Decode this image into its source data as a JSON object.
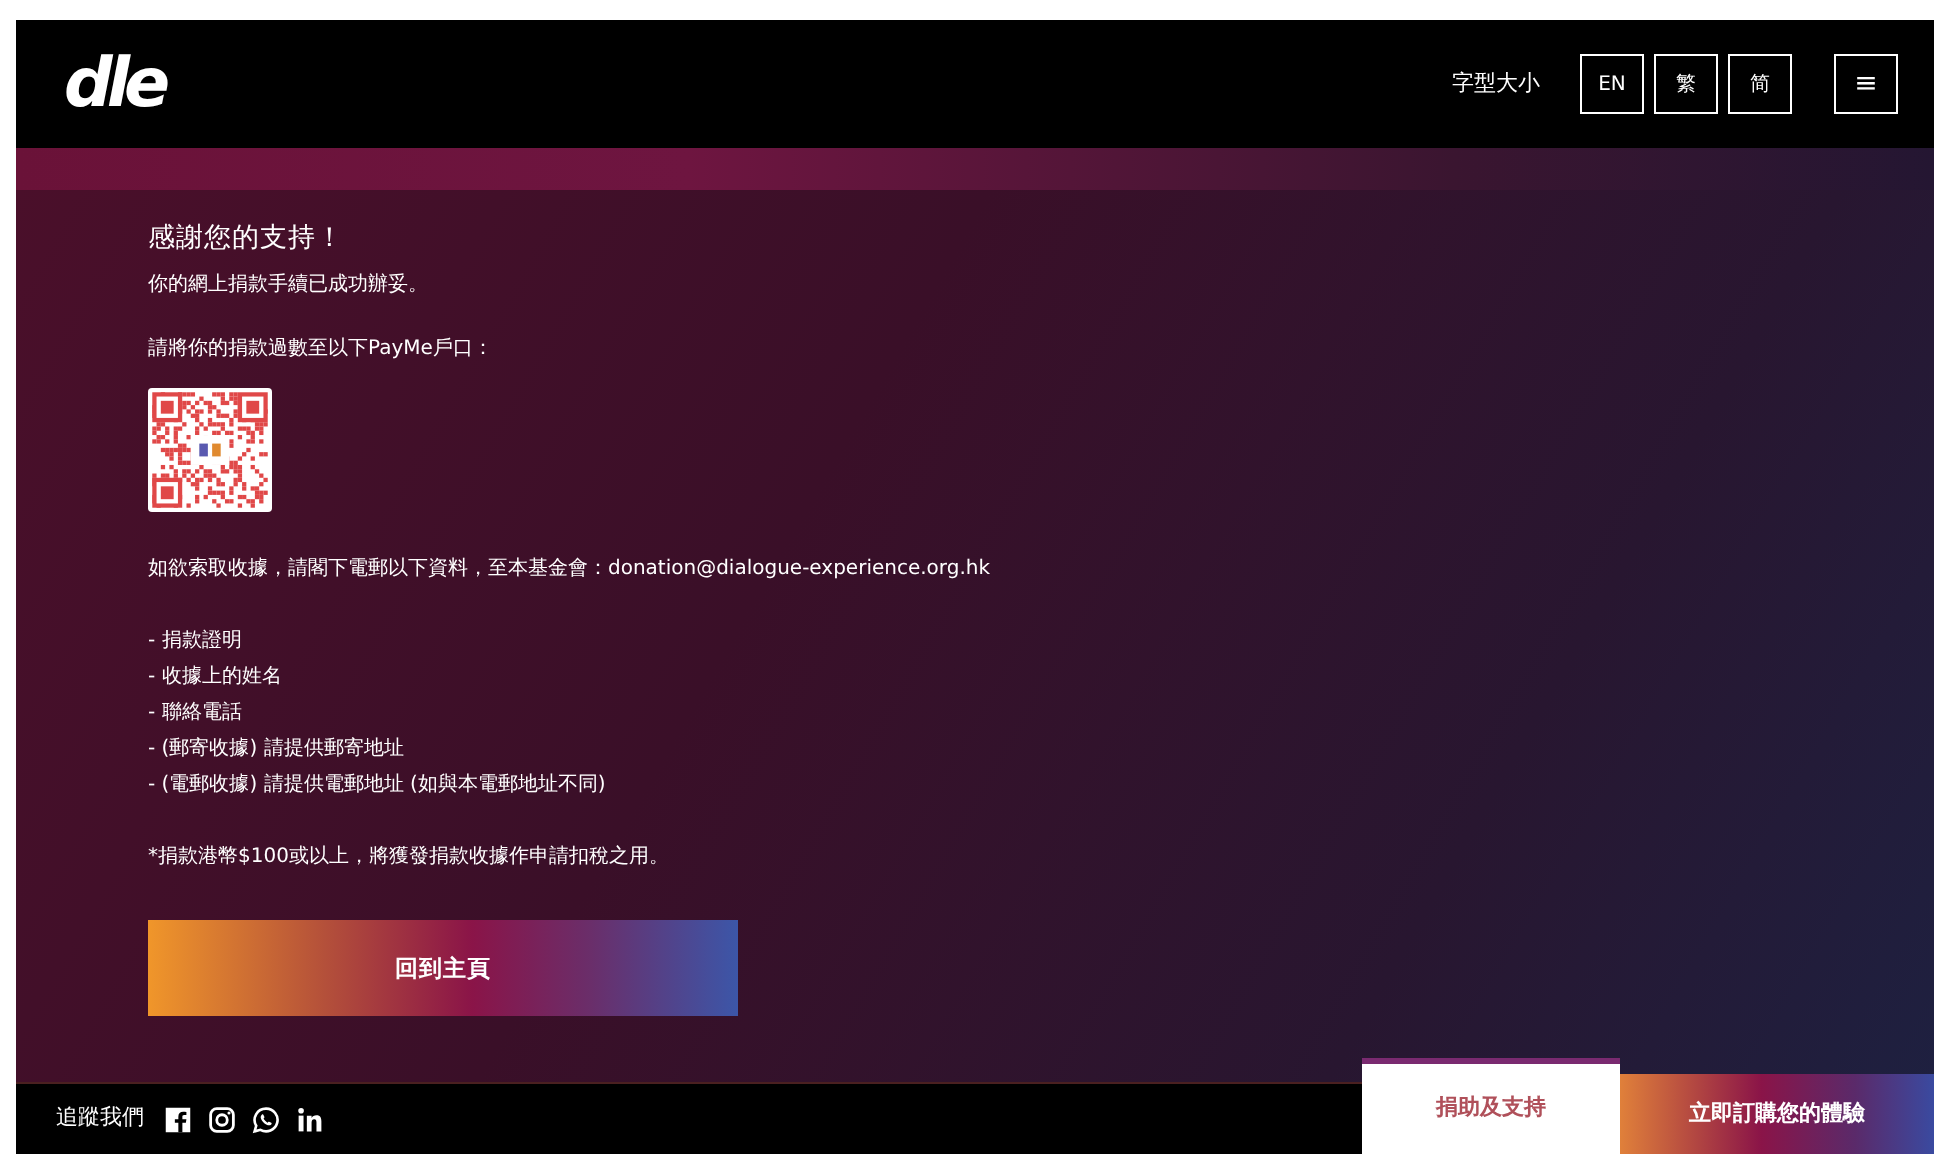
{
  "header": {
    "logo": "dle",
    "font_size_label": "字型大小",
    "languages": [
      {
        "label": "EN"
      },
      {
        "label": "繁"
      },
      {
        "label": "简"
      }
    ],
    "menu_glyph": "≡"
  },
  "content": {
    "title": "感謝您的支持！",
    "paragraphs": [
      "你的網上捐款手續已成功辦妥。",
      "請將你的捐款過數至以下PayMe戶口："
    ],
    "receipt_intro": "如欲索取收據，請閣下電郵以下資料，至本基金會：",
    "email": "donation@dialogue-experience.org.hk",
    "requirements": [
      "- 捐款證明",
      "- 收據上的姓名",
      "- 聯絡電話",
      "- (郵寄收據) 請提供郵寄地址",
      "- (電郵收據) 請提供電郵地址 (如與本電郵地址不同)"
    ],
    "note": "*捐款港幣$100或以上，將獲發捐款收據作申請扣稅之用。",
    "home_button": "回到主頁"
  },
  "footer": {
    "follow_label": "追蹤我們",
    "social": [
      {
        "kind": "facebook"
      },
      {
        "kind": "instagram"
      },
      {
        "kind": "whatsapp"
      },
      {
        "kind": "linkedin"
      }
    ],
    "buttons": [
      {
        "label": "捐助及支持",
        "kind": "outline"
      },
      {
        "label": "立即訂購您的體驗",
        "kind": "filled"
      }
    ]
  }
}
